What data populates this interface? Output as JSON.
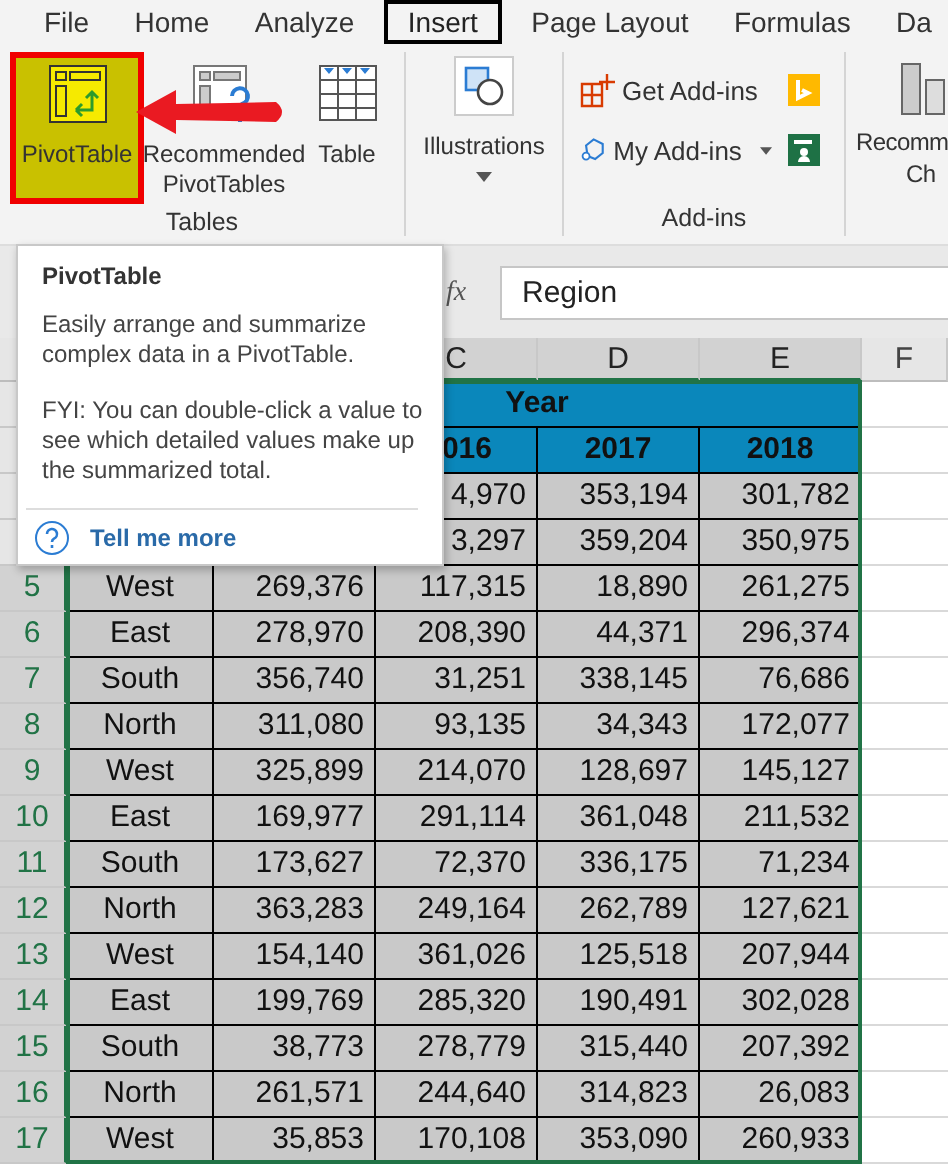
{
  "menu_tabs": [
    {
      "label": "File",
      "selected": false
    },
    {
      "label": "Home",
      "selected": false
    },
    {
      "label": "Analyze",
      "selected": false
    },
    {
      "label": "Insert",
      "selected": true
    },
    {
      "label": "Page Layout",
      "selected": false
    },
    {
      "label": "Formulas",
      "selected": false
    },
    {
      "label": "Da",
      "selected": false
    }
  ],
  "ribbon": {
    "tables": {
      "label": "Tables",
      "buttons": [
        {
          "kind": "pivot",
          "lines": [
            "PivotTable"
          ],
          "highlighted": true
        },
        {
          "kind": "recommended",
          "lines": [
            "Recommended",
            "PivotTables"
          ],
          "highlighted": false
        },
        {
          "kind": "table",
          "lines": [
            "Table"
          ],
          "highlighted": false
        }
      ]
    },
    "illustrations": {
      "label": "Illustrations"
    },
    "add_ins": {
      "label": "Add-ins",
      "items": [
        {
          "kind": "get",
          "label": "Get Add-ins"
        },
        {
          "kind": "my",
          "label": "My Add-ins"
        }
      ]
    },
    "recommended_charts": {
      "lines": [
        "Recomm",
        "Ch"
      ]
    }
  },
  "formula_bar": {
    "function_label": "fx",
    "value": "Region"
  },
  "sheet": {
    "columns": [
      {
        "label": "C",
        "selected": true
      },
      {
        "label": "D",
        "selected": true
      },
      {
        "label": "E",
        "selected": true
      },
      {
        "label": "F",
        "selected": false
      }
    ],
    "title": "Year",
    "years": [
      "016",
      "2017",
      "2018"
    ],
    "rows": [
      {
        "cells": [
          "4,970",
          "353,194",
          "301,782"
        ]
      },
      {
        "cells": [
          "3,297",
          "359,204",
          "350,975"
        ]
      },
      {
        "number": "5",
        "selected": true,
        "region": "West",
        "cells": [
          "269,376",
          "117,315",
          "18,890",
          "261,275"
        ]
      },
      {
        "number": "6",
        "selected": true,
        "region": "East",
        "cells": [
          "278,970",
          "208,390",
          "44,371",
          "296,374"
        ]
      },
      {
        "number": "7",
        "selected": true,
        "region": "South",
        "cells": [
          "356,740",
          "31,251",
          "338,145",
          "76,686"
        ]
      },
      {
        "number": "8",
        "selected": true,
        "region": "North",
        "cells": [
          "311,080",
          "93,135",
          "34,343",
          "172,077"
        ]
      },
      {
        "number": "9",
        "selected": true,
        "region": "West",
        "cells": [
          "325,899",
          "214,070",
          "128,697",
          "145,127"
        ]
      },
      {
        "number": "10",
        "selected": true,
        "region": "East",
        "cells": [
          "169,977",
          "291,114",
          "361,048",
          "211,532"
        ]
      },
      {
        "number": "11",
        "selected": true,
        "region": "South",
        "cells": [
          "173,627",
          "72,370",
          "336,175",
          "71,234"
        ]
      },
      {
        "number": "12",
        "selected": true,
        "region": "North",
        "cells": [
          "363,283",
          "249,164",
          "262,789",
          "127,621"
        ]
      },
      {
        "number": "13",
        "selected": true,
        "region": "West",
        "cells": [
          "154,140",
          "361,026",
          "125,518",
          "207,944"
        ]
      },
      {
        "number": "14",
        "selected": true,
        "region": "East",
        "cells": [
          "199,769",
          "285,320",
          "190,491",
          "302,028"
        ]
      },
      {
        "number": "15",
        "selected": true,
        "region": "South",
        "cells": [
          "38,773",
          "278,779",
          "315,440",
          "207,392"
        ]
      },
      {
        "number": "16",
        "selected": true,
        "region": "North",
        "cells": [
          "261,571",
          "244,640",
          "314,823",
          "26,083"
        ]
      },
      {
        "number": "17",
        "selected": true,
        "region": "West",
        "cells": [
          "35,853",
          "170,108",
          "353,090",
          "260,933"
        ]
      }
    ]
  },
  "tooltip": {
    "title": "PivotTable",
    "paragraphs": [
      "Easily arrange and summarize complex data in a PivotTable.",
      "FYI: You can double-click a value to see which detailed values make up the summarized total."
    ],
    "link": "Tell me more"
  }
}
